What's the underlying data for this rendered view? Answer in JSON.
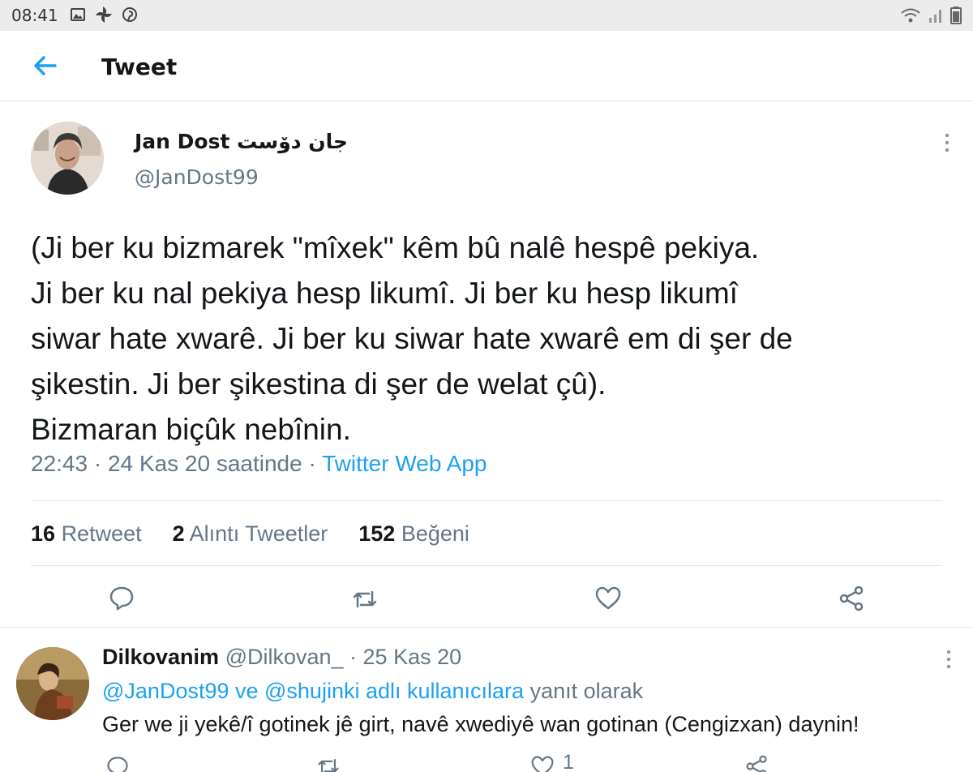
{
  "status_bar": {
    "time": "08:41",
    "left_icons": [
      "image-icon",
      "pinwheel-icon",
      "pinterest-icon"
    ],
    "right_icons": [
      "wifi-icon",
      "signal-icon",
      "battery-icon"
    ]
  },
  "header": {
    "title": "Tweet",
    "accent_color": "#1da1f2"
  },
  "tweet": {
    "author_name": "Jan Dost جان دۆست",
    "author_handle": "@JanDost99",
    "text_lines": [
      "(Ji ber ku bizmarek \"mîxek\" kêm bû nalê hespê pekiya.",
      "Ji ber ku nal pekiya hesp likumî. Ji ber ku hesp likumî",
      "siwar hate xwarê. Ji ber ku siwar hate xwarê em di şer de",
      "şikestin. Ji ber şikestina di şer de welat çû).",
      "Bizmaran biçûk nebînin."
    ],
    "time": "22:43",
    "date": "24 Kas 20 saatinde",
    "separator": "·",
    "source": "Twitter Web App",
    "stats": {
      "retweets_count": "16",
      "retweets_label": "Retweet",
      "quotes_count": "2",
      "quotes_label": "Alıntı Tweetler",
      "likes_count": "152",
      "likes_label": "Beğeni"
    }
  },
  "reply": {
    "author_name": "Dilkovanim",
    "author_handle": "@Dilkovan_",
    "date_text": "· 25 Kas 20",
    "reply_to_mentions": "@JanDost99 ve @shujinki adlı kullanıcılara",
    "reply_to_suffix": "yanıt olarak",
    "text": "Ger we ji yekê/î gotinek jê girt, navê xwediyê wan gotinan (Cengizxan) daynin!",
    "like_count": "1"
  }
}
